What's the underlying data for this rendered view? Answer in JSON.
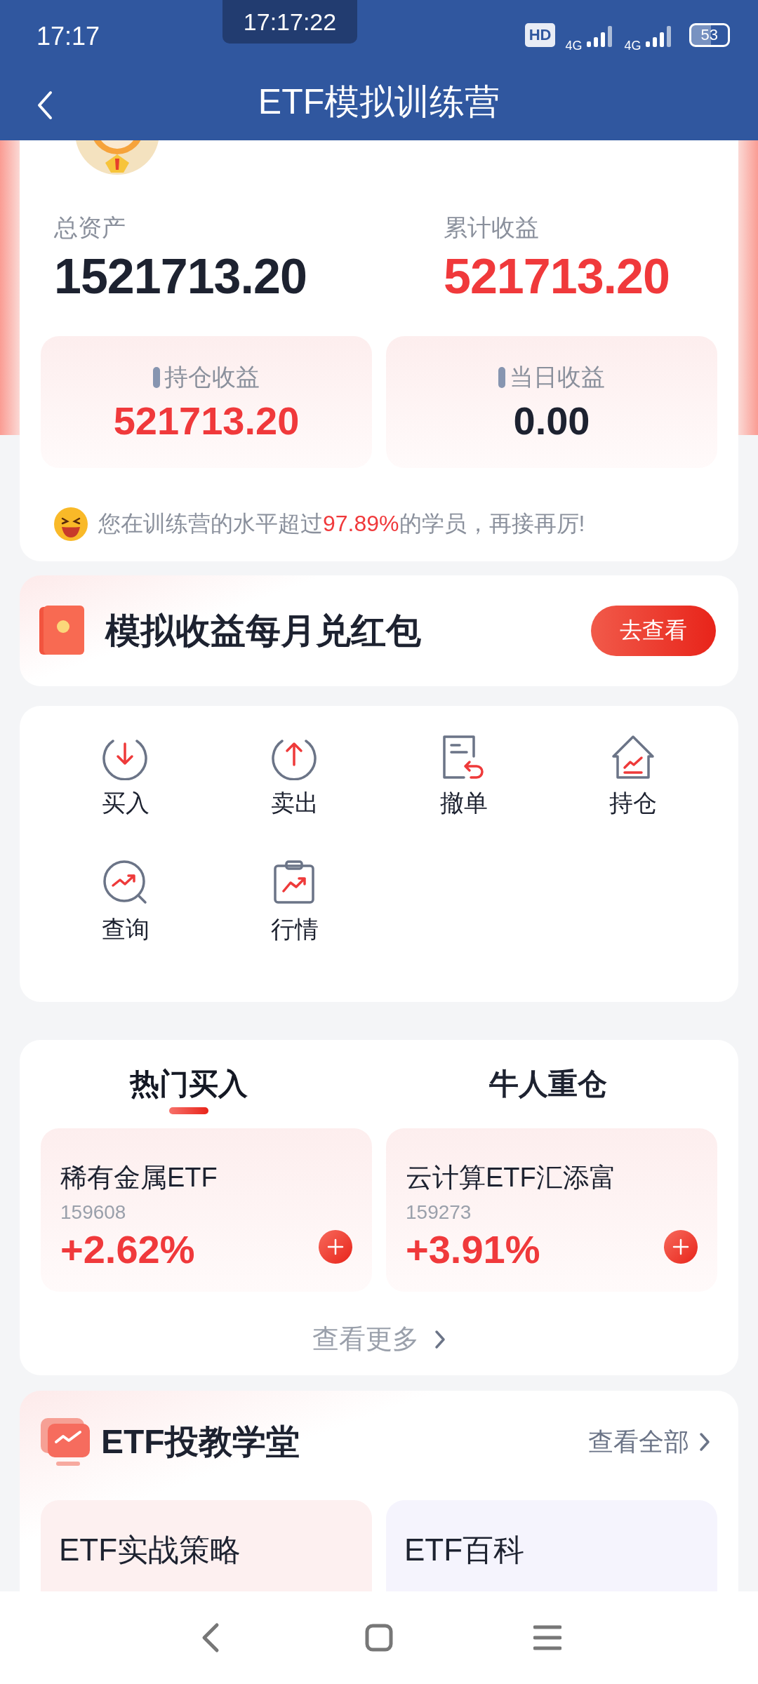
{
  "status_bar": {
    "time": "17:17",
    "clock_overlay": "17:17:22",
    "network_badges": [
      "HD",
      "4G",
      "4G"
    ],
    "battery": "53"
  },
  "header": {
    "title": "ETF模拟训练营"
  },
  "summary": {
    "total_assets_label": "总资产",
    "total_assets": "1521713.20",
    "cumulative_label": "累计收益",
    "cumulative": "521713.20",
    "boxes": [
      {
        "label": "持仓收益",
        "value": "521713.20",
        "color": "#f0393b"
      },
      {
        "label": "当日收益",
        "value": "0.00",
        "color": "#1d2230"
      }
    ],
    "rank_note": "您在训练营的水平超过**97.89%**的学员，再接再厉!"
  },
  "banner": {
    "title": "模拟收益每月兑红包",
    "button": "去查看"
  },
  "actions": [
    {
      "label": "买入",
      "kind": "buy"
    },
    {
      "label": "卖出",
      "kind": "sell"
    },
    {
      "label": "撤单",
      "kind": "cancel"
    },
    {
      "label": "持仓",
      "kind": "holdings"
    },
    {
      "label": "查询",
      "kind": "query"
    },
    {
      "label": "行情",
      "kind": "market"
    }
  ],
  "ranking": {
    "tabs": [
      {
        "label": "热门买入",
        "selected": true
      },
      {
        "label": "牛人重仓",
        "selected": false
      }
    ],
    "items": [
      {
        "name": "稀有金属ETF",
        "code": "159608",
        "change": "+2.62%"
      },
      {
        "name": "云计算ETF汇添富",
        "code": "159273",
        "change": "+3.91%"
      }
    ],
    "more": "查看更多"
  },
  "school": {
    "title": "ETF投教学堂",
    "view_all": "查看全部",
    "cards": [
      "ETF实战策略",
      "ETF百科"
    ]
  }
}
